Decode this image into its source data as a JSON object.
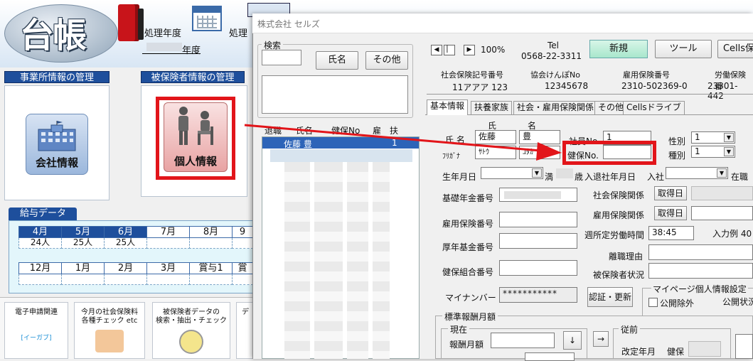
{
  "app": {
    "logo": "台帳",
    "processing_year_label": "処理年度",
    "processing_label2": "処理",
    "year_suffix": "年度",
    "office_header": "事業所情報の管理",
    "insured_header": "被保険者情報の管理",
    "company_tile_label": "会社情報",
    "person_tile_label": "個人情報",
    "salary_header": "給与データ",
    "months_row1": [
      "4月",
      "5月",
      "6月",
      "7月",
      "8月",
      "9"
    ],
    "counts_row1": [
      "24人",
      "25人",
      "25人",
      "",
      "",
      ""
    ],
    "months_row2": [
      "12月",
      "1月",
      "2月",
      "3月",
      "賞与1",
      "賞"
    ],
    "bottom_tiles": [
      {
        "line1": "電子申請関連",
        "line2": "",
        "brand": "[イーガブ]"
      },
      {
        "line1": "今月の社会保険料",
        "line2": "各種チェック etc"
      },
      {
        "line1": "被保険者データの",
        "line2": "検索・抽出・チェック"
      },
      {
        "line1": "デ",
        "line2": ""
      }
    ],
    "colors": {
      "primary": "#1e4f9c",
      "highlight": "#e2151a",
      "selected_row": "#2d64b8"
    }
  },
  "dialog": {
    "title": "株式会社 セルズ",
    "search": {
      "legend": "検索",
      "input_value": "",
      "name_button": "氏名",
      "other_button": "その他"
    },
    "list": {
      "headers": [
        "退職",
        "氏名",
        "健保No",
        "雇",
        "扶"
      ],
      "selected_row": {
        "name": "佐藤 豊",
        "count": "1"
      }
    },
    "nav": {
      "first": "◀",
      "prev": "▏",
      "next": "▶",
      "zoom": "100%"
    },
    "tel_label": "Tel",
    "tel_value": "0568-22-3311",
    "new_button": "新規",
    "tool_button": "ツール",
    "cells_button": "Cells保",
    "info": [
      {
        "label": "社会保険記号番号",
        "value": "11アアア 123"
      },
      {
        "label": "協会けんぽNo",
        "value": "12345678"
      },
      {
        "label": "雇用保険番号",
        "value": "2310-502369-0"
      },
      {
        "label": "労働保険番",
        "value": "23301-442"
      }
    ],
    "tabs": [
      "基本情報",
      "扶養家族",
      "社会・雇用保険関係",
      "その他",
      "Cellsドライブ"
    ],
    "form": {
      "col_sei": "氏",
      "col_mei": "名",
      "name_label": "氏  名",
      "last_name": "佐藤",
      "first_name": "豊",
      "kana_label": "ﾌﾘｶﾞﾅ",
      "kana_last": "ｻﾄｳ",
      "kana_first": "ﾕﾀｶ",
      "emp_no_label": "社員No.",
      "emp_no_value": "1",
      "health_no_label": "健保No.",
      "health_no_value": "",
      "gender_label": "性別",
      "gender_value": "1",
      "kind_label": "種別",
      "kind_value": "1",
      "birth_label": "生年月日",
      "age_prefix": "満",
      "age_suffix": "歳",
      "join_label": "入退社年月日",
      "join_in": "入社",
      "tenure_label": "在職",
      "pension_label": "基礎年金番号",
      "social_ins_label": "社会保険関係",
      "acquire_btn": "取得日",
      "emp_ins_label": "雇用保険番号",
      "emp_ins_rel_label": "雇用保険関係",
      "acquire_btn2": "取得日",
      "weekly_hours_label": "週所定労働時間",
      "weekly_hours_value": "38:45",
      "input_example": "入力例  40",
      "welfare_fund_label": "厚年基金番号",
      "leave_reason_label": "離職理由",
      "health_union_label": "健保組合番号",
      "insured_status_label": "被保険者状況",
      "mynumber_label": "マイナンバー",
      "mynumber_value": "***********",
      "auth_button": "認証・更新",
      "mynumber_group": "マイページ個人情報設定",
      "public_exclude": "公開除外",
      "public_status": "公開状況",
      "std_group": "標準報酬月額",
      "current": "現在",
      "prev": "従前",
      "monthly_label": "報酬月額",
      "down_btn": "↓",
      "right_btn": "→",
      "revise_label": "改定年月",
      "kenpo": "健保"
    }
  }
}
